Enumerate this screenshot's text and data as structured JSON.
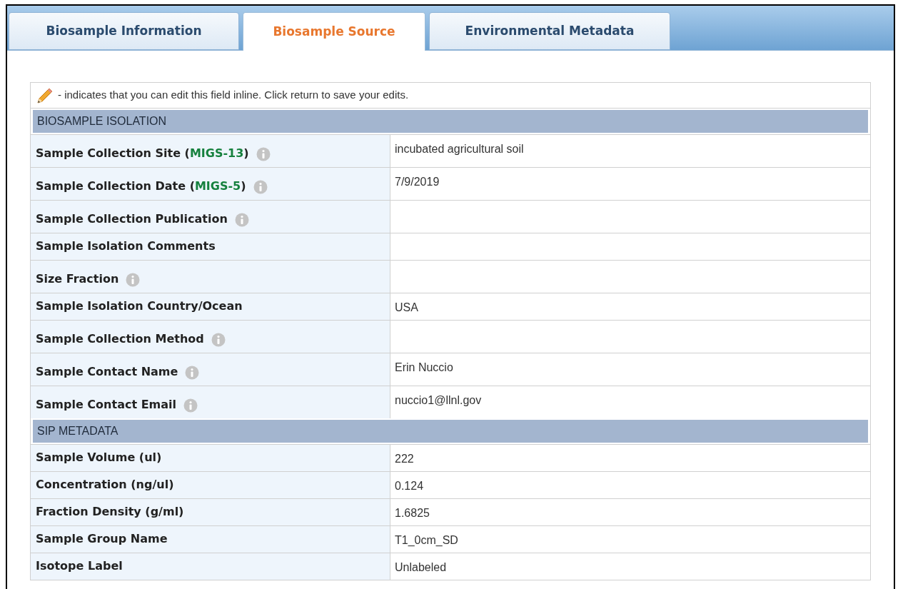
{
  "tabs": [
    {
      "label": "Biosample Information",
      "selected": false
    },
    {
      "label": "Biosample Source",
      "selected": true
    },
    {
      "label": "Environmental Metadata",
      "selected": false
    }
  ],
  "note": "- indicates that you can edit this field inline. Click return to save your edits.",
  "sections": [
    {
      "title": "BIOSAMPLE ISOLATION",
      "rows": [
        {
          "label": "Sample Collection Site (",
          "link": "MIGS-13",
          "label_end": ")",
          "info": true,
          "value": "incubated agricultural soil"
        },
        {
          "label": "Sample Collection Date (",
          "link": "MIGS-5",
          "label_end": ")",
          "info": true,
          "value": "7/9/2019"
        },
        {
          "label": "Sample Collection Publication",
          "info": true
        },
        {
          "label": "Sample Isolation Comments",
          "info": false
        },
        {
          "label": "Size Fraction",
          "info": true
        },
        {
          "label": "Sample Isolation Country/Ocean",
          "info": false,
          "value": "USA"
        },
        {
          "label": "Sample Collection Method",
          "info": true
        },
        {
          "label": "Sample Contact Name",
          "info": true,
          "value": "Erin Nuccio"
        },
        {
          "label": "Sample Contact Email",
          "info": true,
          "value": "nuccio1@llnl.gov"
        }
      ]
    },
    {
      "title": "SIP METADATA",
      "rows": [
        {
          "label": "Sample Volume (ul)",
          "info": false,
          "value": "222"
        },
        {
          "label": "Concentration (ng/ul)",
          "info": false,
          "value": "0.124"
        },
        {
          "label": "Fraction Density (g/ml)",
          "info": false,
          "value": "1.6825"
        },
        {
          "label": "Sample Group Name",
          "info": false,
          "value": "T1_0cm_SD"
        },
        {
          "label": "Isotope Label",
          "info": false,
          "value": "Unlabeled"
        }
      ]
    }
  ]
}
